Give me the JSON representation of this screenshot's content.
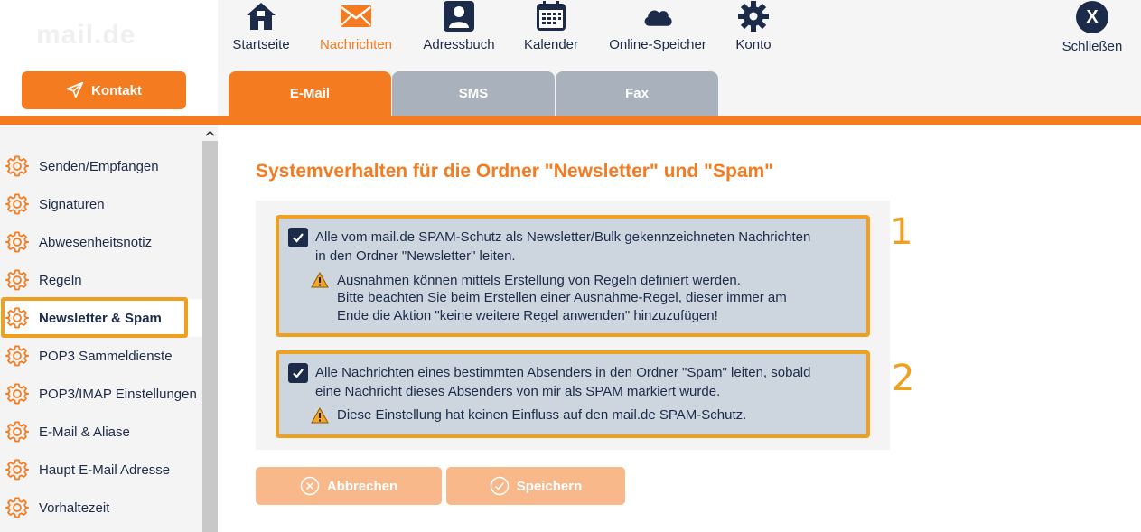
{
  "header": {
    "logo_text": "mail.de",
    "kontakt_label": "Kontakt",
    "nav": [
      {
        "label": "Startseite",
        "icon": "home-icon"
      },
      {
        "label": "Nachrichten",
        "icon": "envelope-icon",
        "active": true
      },
      {
        "label": "Adressbuch",
        "icon": "contact-card-icon"
      },
      {
        "label": "Kalender",
        "icon": "calendar-icon"
      },
      {
        "label": "Online-Speicher",
        "icon": "cloud-icon"
      },
      {
        "label": "Konto",
        "icon": "gear-icon"
      }
    ],
    "close_symbol": "X",
    "close_label": "Schließen"
  },
  "tabs": [
    {
      "label": "E-Mail",
      "active": true
    },
    {
      "label": "SMS"
    },
    {
      "label": "Fax"
    }
  ],
  "sidebar": {
    "items": [
      {
        "label": "Senden/Empfangen"
      },
      {
        "label": "Signaturen"
      },
      {
        "label": "Abwesenheitsnotiz"
      },
      {
        "label": "Regeln"
      },
      {
        "label": "Newsletter & Spam",
        "active": true
      },
      {
        "label": "POP3 Sammeldienste"
      },
      {
        "label": "POP3/IMAP Einstellungen"
      },
      {
        "label": "E-Mail & Aliase"
      },
      {
        "label": "Haupt E-Mail Adresse"
      },
      {
        "label": "Vorhaltezeit"
      }
    ]
  },
  "main": {
    "title": "Systemverhalten für die Ordner \"Newsletter\" und \"Spam\"",
    "options": [
      {
        "checked": true,
        "line1": "Alle vom mail.de SPAM-Schutz als Newsletter/Bulk gekennzeichneten Nachrichten",
        "line2": "in den Ordner \"Newsletter\" leiten.",
        "warn1": "Ausnahmen können mittels Erstellung von Regeln definiert werden.",
        "warn2": "Bitte beachten Sie beim Erstellen einer Ausnahme-Regel, dieser immer am",
        "warn3": "Ende die Aktion \"keine weitere Regel anwenden\" hinzuzufügen!",
        "marker": "1"
      },
      {
        "checked": true,
        "line1": "Alle Nachrichten eines bestimmten Absenders in den Ordner \"Spam\" leiten, sobald",
        "line2": "eine Nachricht dieses Absenders von mir als SPAM markiert wurde.",
        "warn1": "Diese Einstellung hat keinen Einfluss auf den mail.de SPAM-Schutz.",
        "marker": "2"
      }
    ],
    "cancel_label": "Abbrechen",
    "save_label": "Speichern"
  },
  "colors": {
    "accent": "#f47b20",
    "highlight": "#f0a020",
    "navy": "#1c2b4a",
    "tab_inactive": "#a9b1bd",
    "option_bg": "#cdd6de",
    "button_disabled": "#f8b88a"
  }
}
